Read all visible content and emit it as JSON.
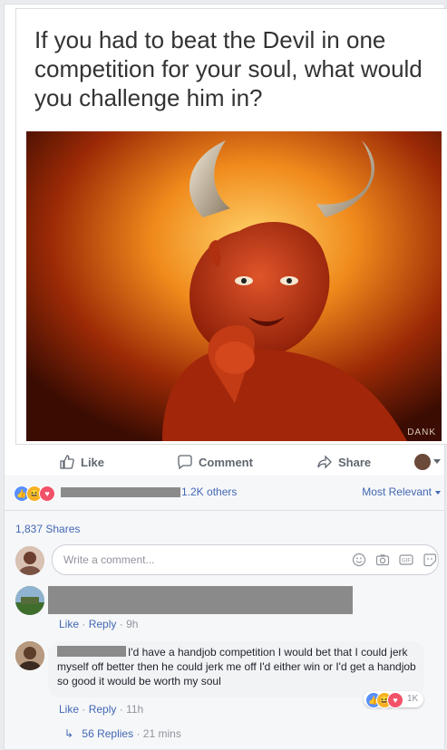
{
  "post": {
    "meme_caption": "If you had to beat the Devil in one competition for your soul, what would you challenge him in?",
    "watermark": "DANK"
  },
  "actions": {
    "like_label": "Like",
    "comment_label": "Comment",
    "share_label": "Share"
  },
  "reactions": {
    "others_text": "1.2K others",
    "sort_label": "Most Relevant",
    "icons": [
      "like-icon",
      "haha-icon",
      "love-icon"
    ],
    "colors": {
      "like": "#5890ff",
      "haha": "#f7b125",
      "love": "#f25268"
    }
  },
  "shares": {
    "label": "1,837 Shares"
  },
  "composer": {
    "placeholder": "Write a comment..."
  },
  "comments": [
    {
      "like_label": "Like",
      "reply_label": "Reply",
      "time": "9h"
    },
    {
      "text": "I'd have a handjob competition I would bet that I could jerk myself off better then he could jerk me off I'd either win or I'd get a handjob so good it would be worth my soul",
      "like_label": "Like",
      "reply_label": "Reply",
      "time": "11h",
      "reaction_count": "1K",
      "replies_label": "56 Replies",
      "replies_time": "21 mins"
    }
  ],
  "separator": "·"
}
